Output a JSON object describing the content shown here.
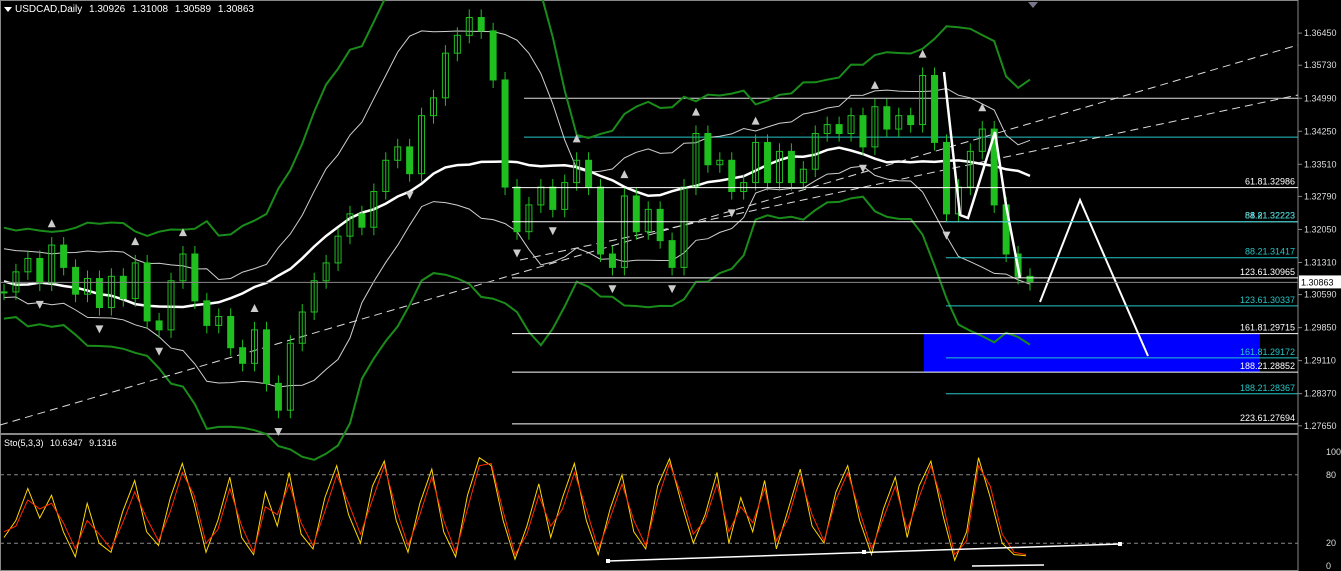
{
  "header": {
    "symbol": "USDCAD,Daily",
    "open": "1.30926",
    "high": "1.31008",
    "low": "1.30589",
    "close": "1.30863"
  },
  "oscillator": {
    "name": "Sto(5,3,3)",
    "main": "10.6347",
    "signal": "9.1316"
  },
  "colors": {
    "background": "#000000",
    "candle": "#1fbf1f",
    "band_outer": "#1a8c1a",
    "band_inner": "#ffffff",
    "fib_white": "#ffffff",
    "fib_cyan": "#26c6c6",
    "zone": "#0000ff",
    "sto_main": "#ffd700",
    "sto_signal": "#ff2a00"
  },
  "chart_data": [
    {
      "type": "candlestick",
      "title": "USDCAD,Daily",
      "ylim": [
        1.2765,
        1.367
      ],
      "yticks": [
        "1.36450",
        "1.35730",
        "1.34990",
        "1.34250",
        "1.33510",
        "1.32790",
        "1.32050",
        "1.31310",
        "1.30590",
        "1.29850",
        "1.29110",
        "1.28370",
        "1.27650"
      ],
      "last_price": "1.30863",
      "price_path": [
        1.3065,
        1.311,
        1.314,
        1.3085,
        1.317,
        1.312,
        1.306,
        1.3095,
        1.303,
        1.31,
        1.305,
        1.313,
        1.3,
        1.298,
        1.309,
        1.315,
        1.3045,
        1.299,
        1.301,
        1.294,
        1.2905,
        1.298,
        1.286,
        1.28,
        1.295,
        1.302,
        1.309,
        1.313,
        1.319,
        1.324,
        1.321,
        1.329,
        1.336,
        1.339,
        1.333,
        1.346,
        1.35,
        1.36,
        1.364,
        1.368,
        1.365,
        1.354,
        1.33,
        1.32,
        1.326,
        1.33,
        1.325,
        1.331,
        1.336,
        1.33,
        1.315,
        1.312,
        1.328,
        1.32,
        1.325,
        1.318,
        1.312,
        1.33,
        1.342,
        1.335,
        1.336,
        1.329,
        1.331,
        1.34,
        1.331,
        1.338,
        1.331,
        1.334,
        1.342,
        1.344,
        1.342,
        1.346,
        1.339,
        1.348,
        1.343,
        1.346,
        1.344,
        1.355,
        1.34,
        1.324,
        1.33,
        1.338,
        1.343,
        1.326,
        1.315,
        1.31,
        1.3086
      ],
      "fib_levels_white": [
        {
          "label": "61.81.32986",
          "value": 1.32986
        },
        {
          "label": "88.21.32223",
          "value": 1.32223
        },
        {
          "label": "123.61.30965",
          "value": 1.30965
        },
        {
          "label": "161.81.29715",
          "value": 1.29715
        },
        {
          "label": "188.21.28852",
          "value": 1.28852
        },
        {
          "label": "223.61.27694",
          "value": 1.27694
        }
      ],
      "fib_levels_cyan": [
        {
          "label": "61.81.32223",
          "value": 1.32223
        },
        {
          "label": "88.21.31417",
          "value": 1.31417
        },
        {
          "label": "123.61.30337",
          "value": 1.30337
        },
        {
          "label": "161.81.29172",
          "value": 1.29172
        },
        {
          "label": "188.21.28367",
          "value": 1.28367
        }
      ],
      "horizontal_levels": [
        1.3499,
        1.3412
      ],
      "target_zone": {
        "from": 1.28852,
        "to": 1.29715
      }
    },
    {
      "type": "line",
      "title": "Sto(5,3,3)",
      "ylim": [
        0,
        100
      ],
      "yticks": [
        "100",
        "80",
        "20",
        "0"
      ],
      "levels": [
        80,
        20
      ],
      "series": [
        {
          "name": "main",
          "values": [
            25,
            40,
            68,
            42,
            62,
            30,
            8,
            55,
            20,
            12,
            48,
            75,
            30,
            18,
            60,
            90,
            55,
            12,
            40,
            78,
            25,
            10,
            65,
            35,
            82,
            28,
            15,
            60,
            88,
            45,
            20,
            70,
            92,
            40,
            12,
            55,
            85,
            30,
            8,
            62,
            95,
            88,
            40,
            6,
            35,
            72,
            25,
            60,
            90,
            40,
            10,
            50,
            80,
            30,
            15,
            70,
            94,
            55,
            20,
            45,
            82,
            20,
            60,
            30,
            75,
            15,
            50,
            85,
            35,
            20,
            65,
            88,
            40,
            10,
            50,
            78,
            25,
            70,
            92,
            45,
            5,
            30,
            95,
            60,
            20,
            10,
            9
          ]
        },
        {
          "name": "signal",
          "values": [
            30,
            35,
            58,
            50,
            55,
            38,
            15,
            40,
            28,
            15,
            38,
            65,
            42,
            22,
            48,
            82,
            62,
            20,
            32,
            68,
            35,
            12,
            52,
            45,
            72,
            38,
            18,
            48,
            80,
            55,
            28,
            58,
            88,
            50,
            18,
            45,
            78,
            40,
            12,
            50,
            88,
            90,
            48,
            10,
            28,
            62,
            35,
            50,
            82,
            50,
            15,
            42,
            72,
            40,
            18,
            58,
            90,
            62,
            28,
            40,
            72,
            30,
            52,
            38,
            68,
            22,
            42,
            78,
            45,
            22,
            58,
            82,
            48,
            15,
            42,
            70,
            32,
            60,
            88,
            55,
            10,
            22,
            88,
            70,
            28,
            12,
            10
          ]
        }
      ]
    }
  ]
}
